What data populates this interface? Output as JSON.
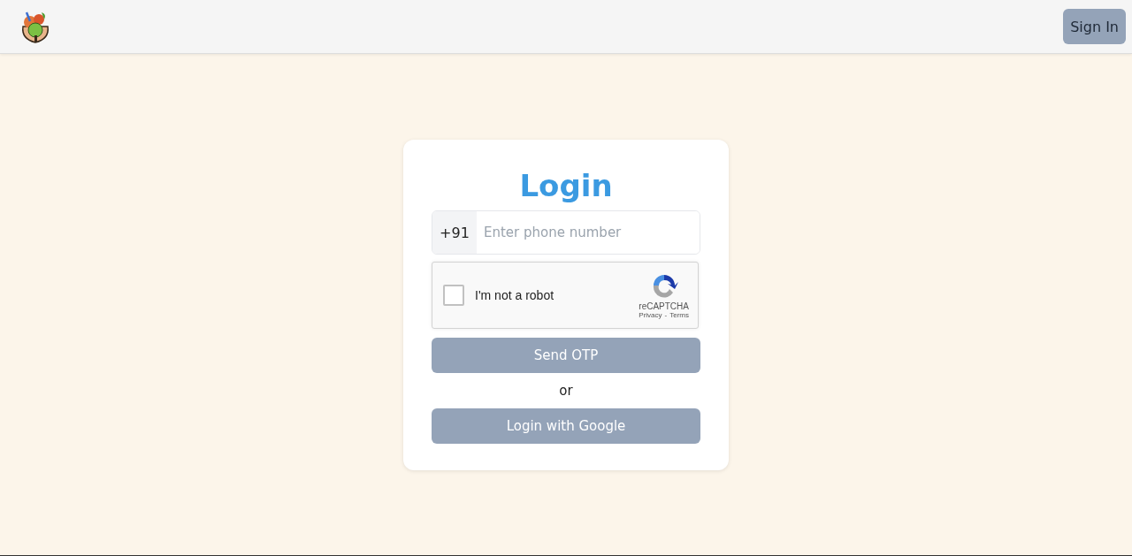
{
  "header": {
    "sign_in": "Sign In"
  },
  "login": {
    "title": "Login",
    "country_code": "+91",
    "phone_placeholder": "Enter phone number",
    "captcha": {
      "label": "I'm not a robot",
      "checked": false,
      "brand": "reCAPTCHA",
      "links": [
        "Privacy",
        "Terms"
      ],
      "separator": "-"
    },
    "send_button": "Send OTP",
    "or": "or",
    "google_button": "Login with Google"
  }
}
